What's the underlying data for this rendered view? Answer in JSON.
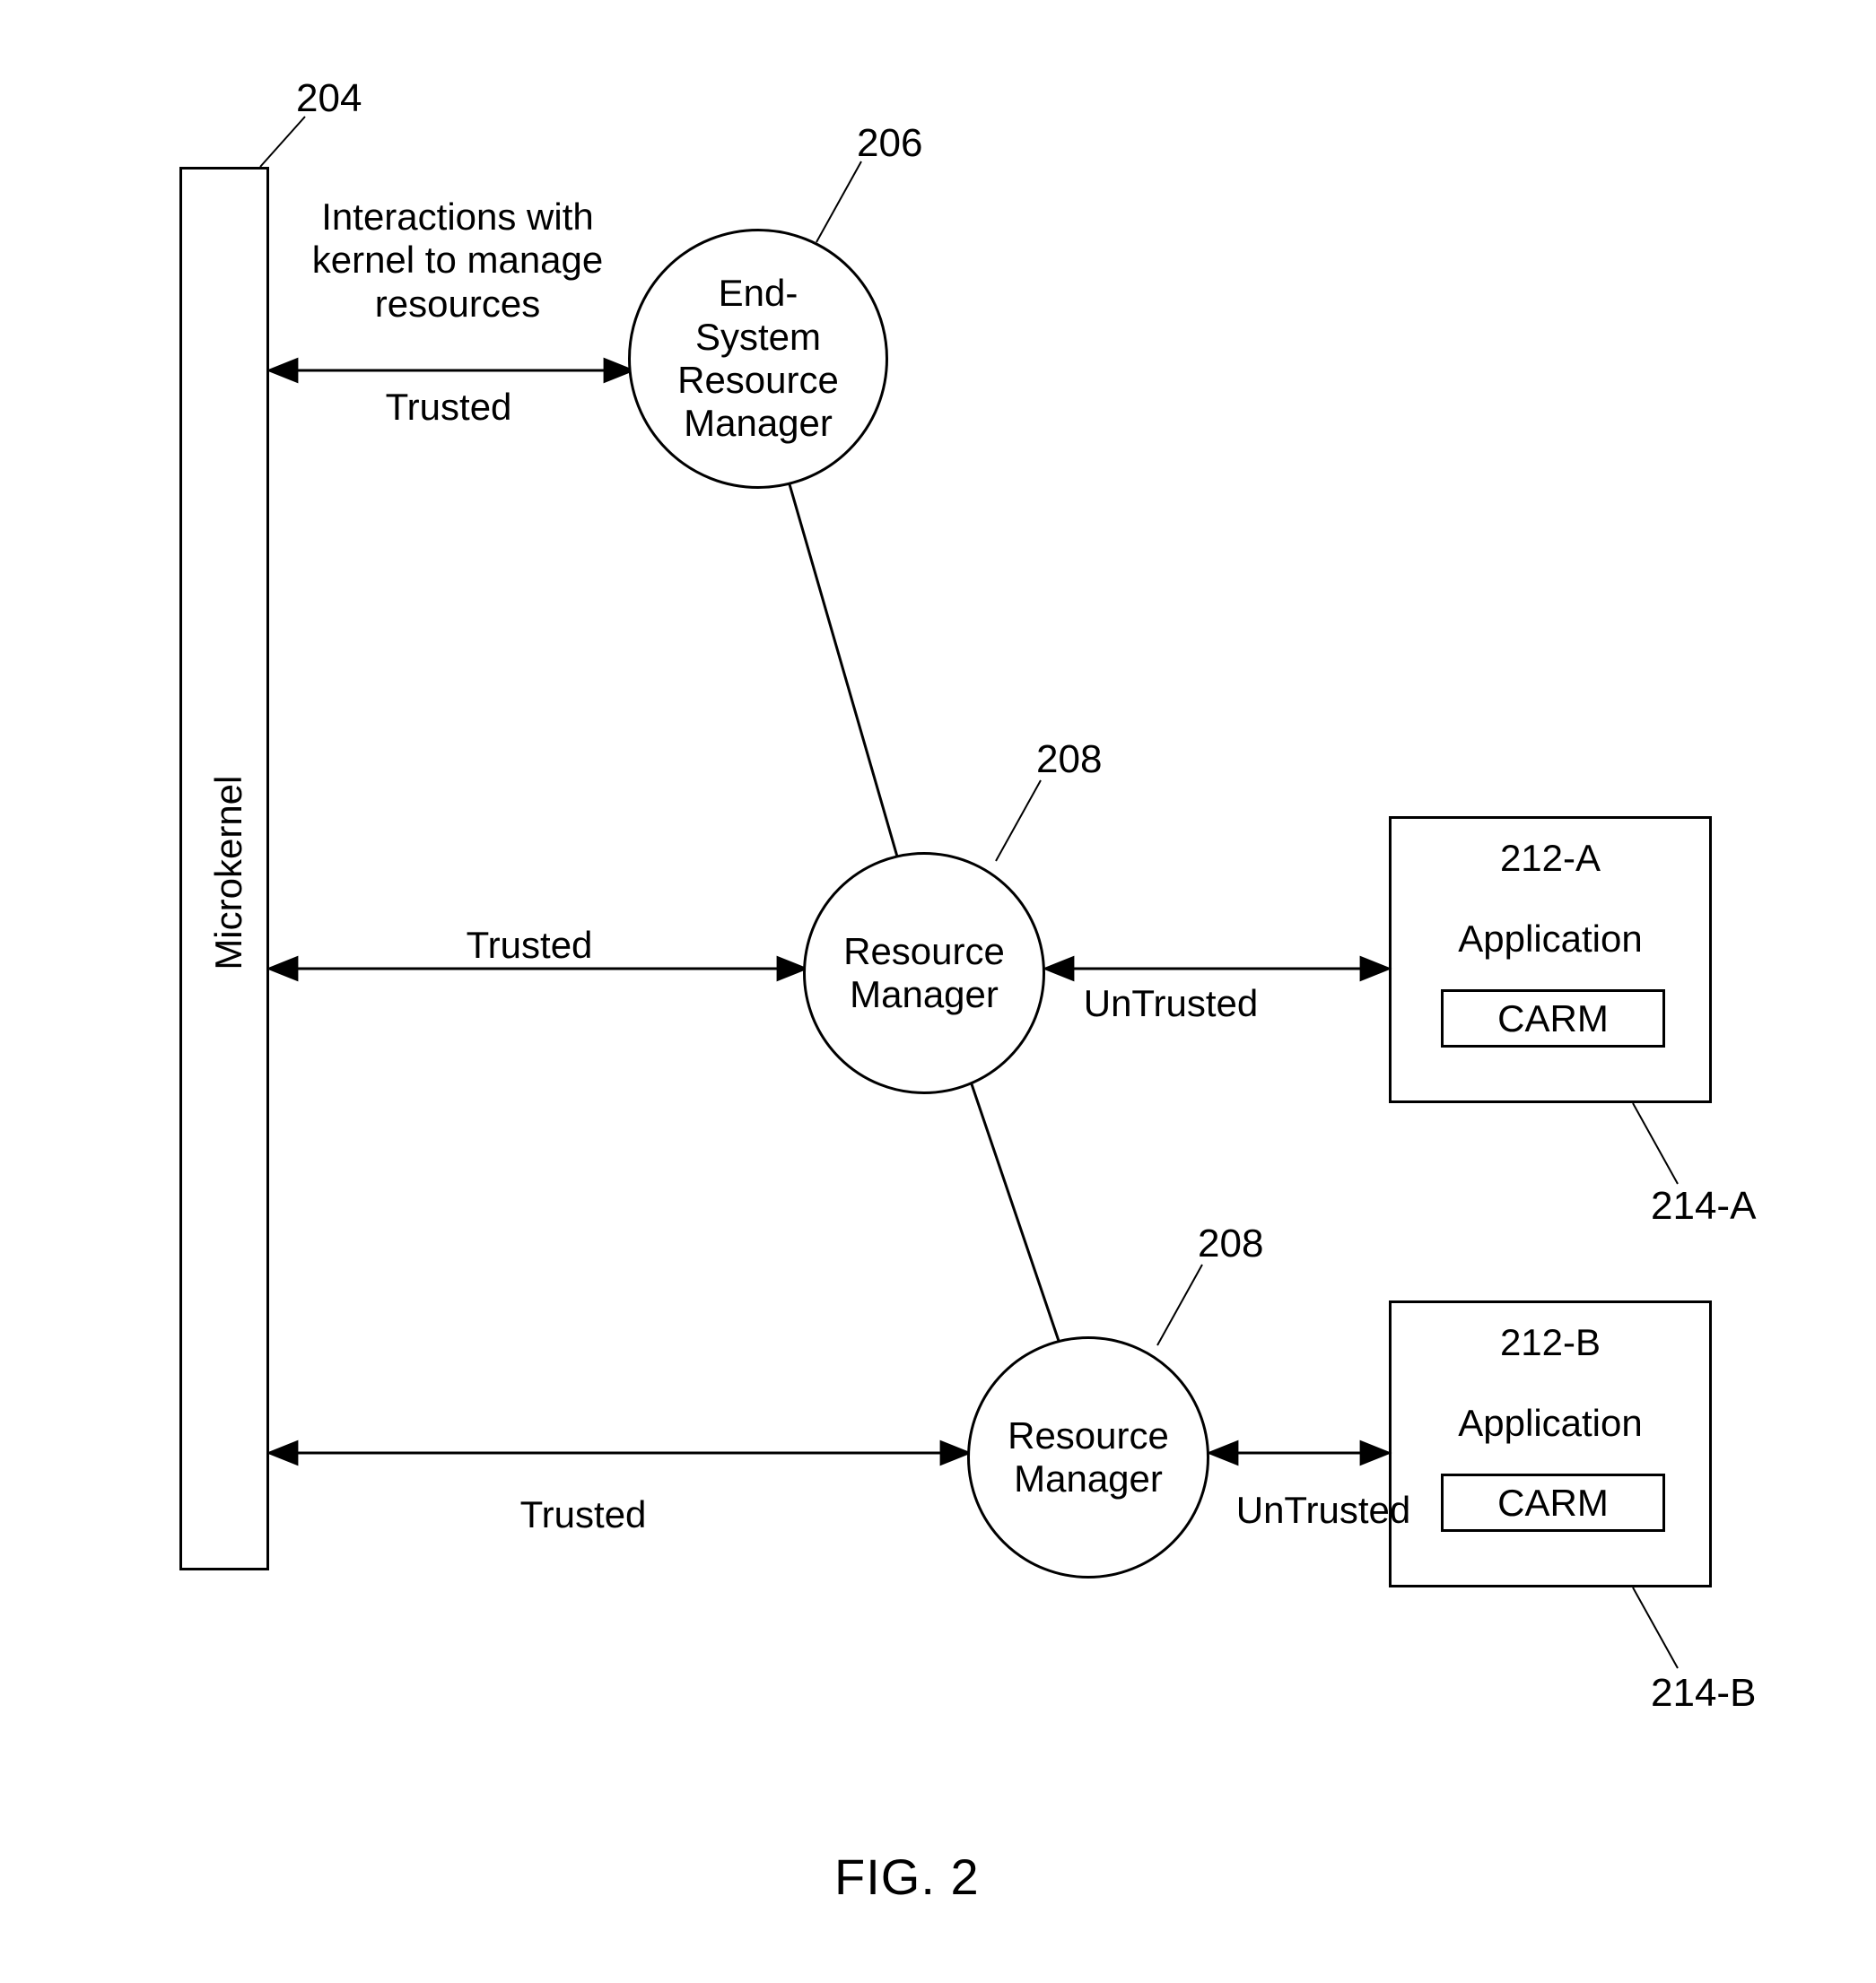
{
  "figure_label": "FIG. 2",
  "microkernel": {
    "ref": "204",
    "label": "Microkernel"
  },
  "esrm": {
    "ref": "206",
    "label": "End-\nSystem\nResource\nManager"
  },
  "rm1": {
    "ref": "208",
    "label": "Resource\nManager"
  },
  "rm2": {
    "ref": "208",
    "label": "Resource\nManager"
  },
  "appA": {
    "ref": "212-A",
    "title": "Application",
    "carm_ref": "214-A",
    "carm_label": "CARM"
  },
  "appB": {
    "ref": "212-B",
    "title": "Application",
    "carm_ref": "214-B",
    "carm_label": "CARM"
  },
  "edge_labels": {
    "kernel_interactions": "Interactions with\nkernel to manage\nresources",
    "trusted": "Trusted",
    "untrusted": "UnTrusted"
  }
}
